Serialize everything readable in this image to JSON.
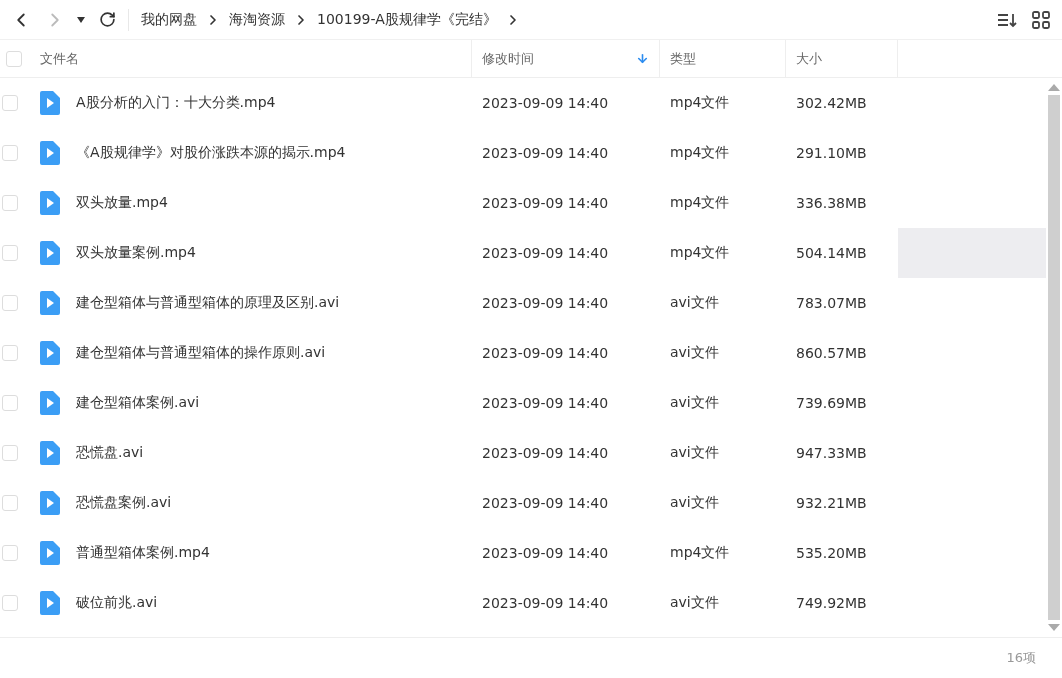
{
  "breadcrumbs": [
    "我的网盘",
    "海淘资源",
    "100199-A股规律学《完结》"
  ],
  "table": {
    "select_all_checked": false,
    "columns": [
      {
        "label": "文件名",
        "sorted": false
      },
      {
        "label": "修改时间",
        "sorted": true
      },
      {
        "label": "类型",
        "sorted": false
      },
      {
        "label": "大小",
        "sorted": false
      }
    ],
    "rows": [
      {
        "name": "A股分析的入门：十大分类.mp4",
        "modified": "2023-09-09 14:40",
        "type": "mp4文件",
        "size": "302.42MB",
        "hovered": false,
        "checked": false
      },
      {
        "name": "《A股规律学》对股价涨跌本源的揭示.mp4",
        "modified": "2023-09-09 14:40",
        "type": "mp4文件",
        "size": "291.10MB",
        "hovered": false,
        "checked": false
      },
      {
        "name": "双头放量.mp4",
        "modified": "2023-09-09 14:40",
        "type": "mp4文件",
        "size": "336.38MB",
        "hovered": false,
        "checked": false
      },
      {
        "name": "双头放量案例.mp4",
        "modified": "2023-09-09 14:40",
        "type": "mp4文件",
        "size": "504.14MB",
        "hovered": true,
        "checked": false
      },
      {
        "name": "建仓型箱体与普通型箱体的原理及区别.avi",
        "modified": "2023-09-09 14:40",
        "type": "avi文件",
        "size": "783.07MB",
        "hovered": false,
        "checked": false
      },
      {
        "name": "建仓型箱体与普通型箱体的操作原则.avi",
        "modified": "2023-09-09 14:40",
        "type": "avi文件",
        "size": "860.57MB",
        "hovered": false,
        "checked": false
      },
      {
        "name": "建仓型箱体案例.avi",
        "modified": "2023-09-09 14:40",
        "type": "avi文件",
        "size": "739.69MB",
        "hovered": false,
        "checked": false
      },
      {
        "name": "恐慌盘.avi",
        "modified": "2023-09-09 14:40",
        "type": "avi文件",
        "size": "947.33MB",
        "hovered": false,
        "checked": false
      },
      {
        "name": "恐慌盘案例.avi",
        "modified": "2023-09-09 14:40",
        "type": "avi文件",
        "size": "932.21MB",
        "hovered": false,
        "checked": false
      },
      {
        "name": "普通型箱体案例.mp4",
        "modified": "2023-09-09 14:40",
        "type": "mp4文件",
        "size": "535.20MB",
        "hovered": false,
        "checked": false
      },
      {
        "name": "破位前兆.avi",
        "modified": "2023-09-09 14:40",
        "type": "avi文件",
        "size": "749.92MB",
        "hovered": false,
        "checked": false
      }
    ]
  },
  "status_bar": {
    "count": "16项"
  }
}
